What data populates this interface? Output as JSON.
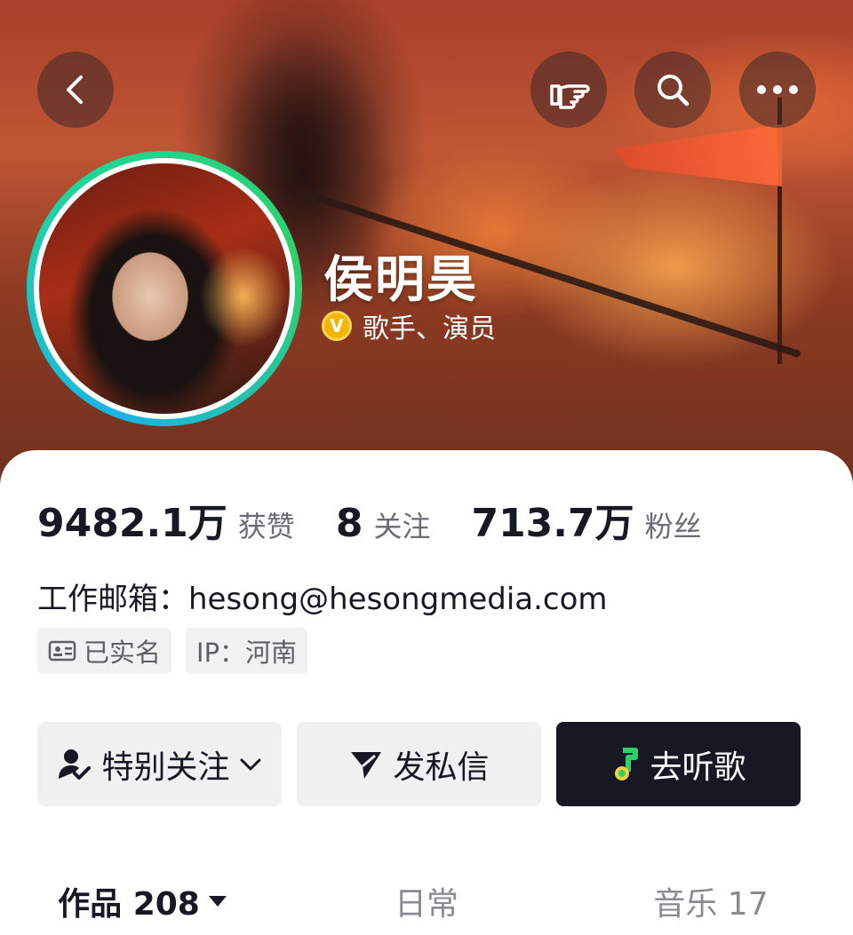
{
  "header": {
    "icons": [
      "back-arrow-icon",
      "pointing-hand-icon",
      "search-icon",
      "more-dots-icon"
    ]
  },
  "profile": {
    "name": "侯明昊",
    "verify_badge": "V",
    "verify_text": "歌手、演员",
    "avatar_ring_colors": [
      "#19b4e8",
      "#1fd59a",
      "#2fd06a"
    ]
  },
  "stats": [
    {
      "value": "9482.1万",
      "label": "获赞"
    },
    {
      "value": "8",
      "label": "关注"
    },
    {
      "value": "713.7万",
      "label": "粉丝"
    }
  ],
  "contact": {
    "email_line": "工作邮箱：hesong@hesongmedia.com"
  },
  "tags": [
    {
      "icon": "id-card-icon",
      "label": "已实名"
    },
    {
      "label": "IP：河南"
    }
  ],
  "actions": {
    "follow_label": "特别关注",
    "message_label": "发私信",
    "music_label": "去听歌",
    "primary_color": "#161823"
  },
  "tabs": [
    {
      "label": "作品 208",
      "active": true
    },
    {
      "label": "日常",
      "active": false
    },
    {
      "label": "音乐 17",
      "active": false
    }
  ]
}
